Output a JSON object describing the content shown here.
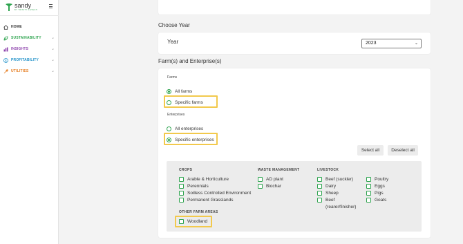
{
  "brand": {
    "name": "sandy",
    "tagline": "BY TRINITY AGTECH",
    "accent": "#2ea44f"
  },
  "nav": [
    {
      "label": "HOME",
      "icon": "home-icon",
      "color": "#333333"
    },
    {
      "label": "SUSTAINABILITY",
      "icon": "leaf-icon",
      "color": "#2ea44f"
    },
    {
      "label": "INSIGHTS",
      "icon": "bar-chart-icon",
      "color": "#8e44ad"
    },
    {
      "label": "PROFITABILITY",
      "icon": "dollar-icon",
      "color": "#1e90c8"
    },
    {
      "label": "UTILITIES",
      "icon": "wrench-icon",
      "color": "#e67e22"
    }
  ],
  "choose_year": {
    "title": "Choose Year",
    "label": "Year",
    "selected": "2023"
  },
  "farms_section": {
    "title": "Farm(s) and Enterprise(s)",
    "farms_label": "Farms",
    "farm_options": [
      {
        "label": "All farms",
        "checked": true
      },
      {
        "label": "Specific farms",
        "checked": false
      }
    ],
    "enterprises_label": "Enterprises",
    "enterprise_options": [
      {
        "label": "All enterprises",
        "checked": false
      },
      {
        "label": "Specific enterprises",
        "checked": true
      }
    ],
    "select_all": "Select all",
    "deselect_all": "Deselect all"
  },
  "enterprises": {
    "crops": {
      "title": "CROPS",
      "items": [
        "Arable & Horticulture",
        "Perennials",
        "Soilless Controlled Environment",
        "Permanent Grasslands"
      ]
    },
    "waste": {
      "title": "WASTE MANAGEMENT",
      "items": [
        "AD plant",
        "Biochar"
      ]
    },
    "livestock": {
      "title": "LIVESTOCK",
      "col1": [
        "Beef (suckler)",
        "Dairy",
        "Sheep",
        "Beef (rearer/finisher)"
      ],
      "col2": [
        "Poultry",
        "Eggs",
        "Pigs",
        "Goats"
      ]
    },
    "other": {
      "title": "OTHER FARM AREAS",
      "items": [
        "Woodland"
      ]
    }
  }
}
